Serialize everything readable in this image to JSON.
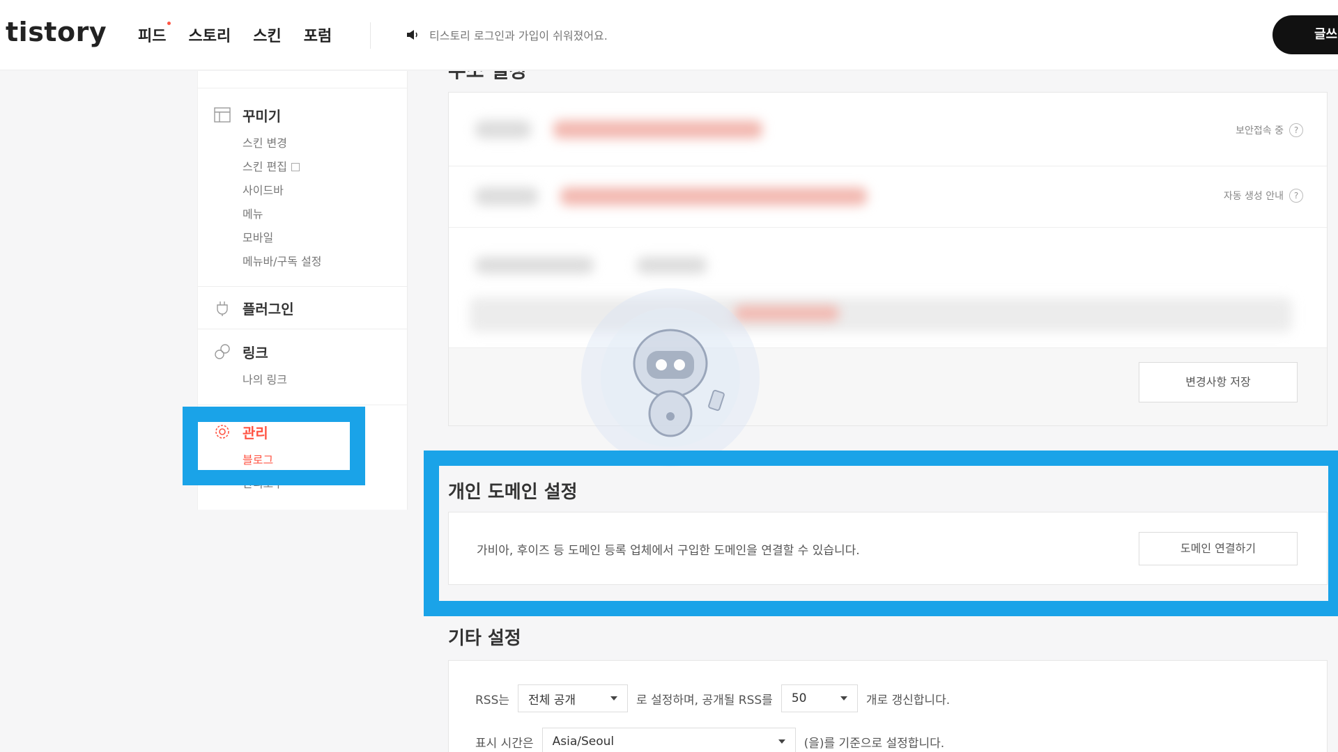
{
  "header": {
    "logo": "tistory",
    "nav": [
      "피드",
      "스토리",
      "스킨",
      "포럼"
    ],
    "notice": "티스토리 로그인과 가입이 쉬워졌어요.",
    "write_button": "글쓰"
  },
  "sidebar": {
    "decorate": {
      "label": "꾸미기",
      "items": [
        "스킨 변경",
        "스킨 편집",
        "사이드바",
        "메뉴",
        "모바일",
        "메뉴바/구독 설정"
      ]
    },
    "plugin": {
      "label": "플러그인"
    },
    "link": {
      "label": "링크",
      "items": [
        "나의 링크"
      ]
    },
    "manage": {
      "label": "관리",
      "items": [
        "블로그",
        "관리도구"
      ]
    }
  },
  "address_card": {
    "title": "주소 설정",
    "row1_note": "보안접속 중",
    "row2_note": "자동 생성 안내",
    "help": "?",
    "save_button": "변경사항 저장"
  },
  "domain": {
    "title": "개인 도메인 설정",
    "description": "가비아, 후이즈 등 도메인 등록 업체에서 구입한 도메인을 연결할 수 있습니다.",
    "connect_button": "도메인 연결하기"
  },
  "etc": {
    "title": "기타 설정",
    "rss_prefix": "RSS는",
    "rss_scope": "전체 공개",
    "rss_middle": "로 설정하며, 공개될 RSS를",
    "rss_count": "50",
    "rss_suffix": "개로 갱신합니다.",
    "tz_prefix": "표시 시간은",
    "timezone": "Asia/Seoul",
    "tz_suffix": "(을)를 기준으로 설정합니다."
  },
  "colors": {
    "accent": "#ff5544",
    "highlight": "#1aa3e8"
  }
}
